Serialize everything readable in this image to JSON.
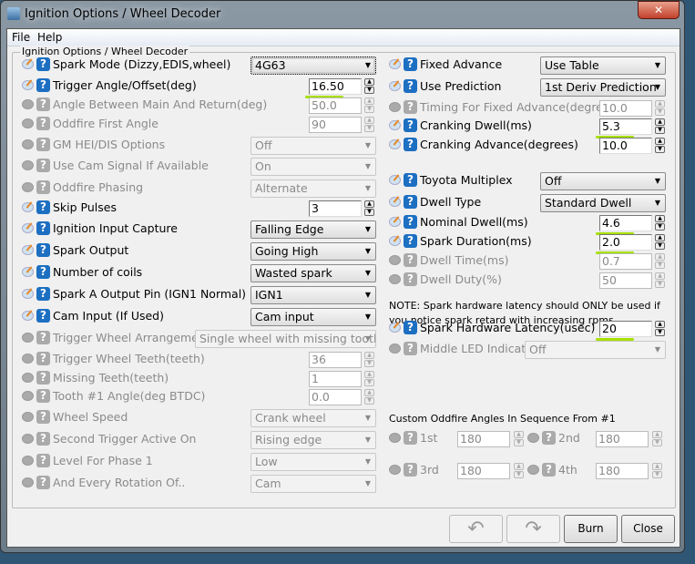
{
  "window": {
    "title": "Ignition Options / Wheel Decoder",
    "close": "✕"
  },
  "menu": [
    "File",
    "Help"
  ],
  "group_title": "Ignition Options / Wheel Decoder",
  "left": [
    {
      "label": "Spark Mode (Dizzy,EDIS,wheel)",
      "type": "combo",
      "value": "4G63",
      "enabled": true,
      "focus": true
    },
    {
      "label": "Trigger Angle/Offset(deg)",
      "type": "input",
      "value": "16.50",
      "enabled": true,
      "highlighted": true
    },
    {
      "label": "Angle Between Main And Return(deg)",
      "type": "input",
      "value": "50.0",
      "enabled": false
    },
    {
      "label": "Oddfire First Angle",
      "type": "input",
      "value": "90",
      "enabled": false
    },
    {
      "label": "GM HEI/DIS Options",
      "type": "combo",
      "value": "Off",
      "enabled": false
    },
    {
      "label": "Use Cam Signal If Available",
      "type": "combo",
      "value": "On",
      "enabled": false
    },
    {
      "label": "Oddfire Phasing",
      "type": "combo",
      "value": "Alternate",
      "enabled": false
    },
    {
      "label": "Skip Pulses",
      "type": "input",
      "value": "3",
      "enabled": true
    },
    {
      "label": "Ignition Input Capture",
      "type": "combo",
      "value": "Falling Edge",
      "enabled": true
    },
    {
      "label": "Spark Output",
      "type": "combo",
      "value": "Going High",
      "enabled": true
    },
    {
      "label": "Number of coils",
      "type": "combo",
      "value": "Wasted spark",
      "enabled": true
    },
    {
      "label": "Spark A Output Pin (IGN1 Normal)",
      "type": "combo",
      "value": "IGN1",
      "enabled": true
    },
    {
      "label": "Cam Input (If Used)",
      "type": "combo",
      "value": "Cam input",
      "enabled": true
    },
    {
      "label": "Trigger Wheel Arrangement",
      "type": "widecombo",
      "value": "Single wheel with missing tooth",
      "enabled": false
    },
    {
      "label": "Trigger Wheel Teeth(teeth)",
      "type": "input",
      "value": "36",
      "enabled": false
    },
    {
      "label": "Missing Teeth(teeth)",
      "type": "input",
      "value": "1",
      "enabled": false
    },
    {
      "label": "Tooth #1 Angle(deg BTDC)",
      "type": "input",
      "value": "0.0",
      "enabled": false
    },
    {
      "label": "Wheel Speed",
      "type": "combo",
      "value": "Crank wheel",
      "enabled": false
    },
    {
      "label": "Second Trigger Active On",
      "type": "combo",
      "value": "Rising edge",
      "enabled": false
    },
    {
      "label": "Level For Phase 1",
      "type": "combo",
      "value": "Low",
      "enabled": false
    },
    {
      "label": "And Every Rotation Of..",
      "type": "combo",
      "value": "Cam",
      "enabled": false
    }
  ],
  "right": [
    {
      "label": "Fixed Advance",
      "type": "combo",
      "value": "Use Table",
      "enabled": true
    },
    {
      "label": "Use Prediction",
      "type": "combo",
      "value": "1st Deriv Prediction",
      "enabled": true
    },
    {
      "label": "Timing For Fixed Advance(degrees)",
      "type": "input",
      "value": "10.0",
      "enabled": false
    },
    {
      "label": "Cranking Dwell(ms)",
      "type": "input",
      "value": "5.3",
      "enabled": true,
      "highlighted": true
    },
    {
      "label": "Cranking Advance(degrees)",
      "type": "input",
      "value": "10.0",
      "enabled": true
    },
    {
      "label": "Toyota Multiplex",
      "type": "combo",
      "value": "Off",
      "enabled": true
    },
    {
      "label": "Dwell Type",
      "type": "combo",
      "value": "Standard Dwell",
      "enabled": true
    },
    {
      "label": "Nominal Dwell(ms)",
      "type": "input",
      "value": "4.6",
      "enabled": true,
      "highlighted": true
    },
    {
      "label": "Spark Duration(ms)",
      "type": "input",
      "value": "2.0",
      "enabled": true,
      "highlighted": true
    },
    {
      "label": "Dwell Time(ms)",
      "type": "input",
      "value": "0.7",
      "enabled": false
    },
    {
      "label": "Dwell Duty(%)",
      "type": "input",
      "value": "50",
      "enabled": false
    },
    {
      "label": "Spark Hardware Latency(usec)",
      "type": "input",
      "value": "20",
      "enabled": true,
      "highlighted": true
    },
    {
      "label": "Middle LED Indicator",
      "type": "widecombo",
      "value": "Off",
      "enabled": false
    }
  ],
  "note": [
    "NOTE: Spark hardware latency should ONLY be used if",
    "you notice spark retard with increasing rpms."
  ],
  "oddfire": {
    "title": "Custom Oddfire Angles In Sequence From #1",
    "items": [
      {
        "label": "1st",
        "value": "180"
      },
      {
        "label": "2nd",
        "value": "180"
      },
      {
        "label": "3rd",
        "value": "180"
      },
      {
        "label": "4th",
        "value": "180"
      }
    ]
  },
  "buttons": {
    "undo": "↶",
    "redo": "↷",
    "burn": "Burn",
    "close": "Close"
  }
}
